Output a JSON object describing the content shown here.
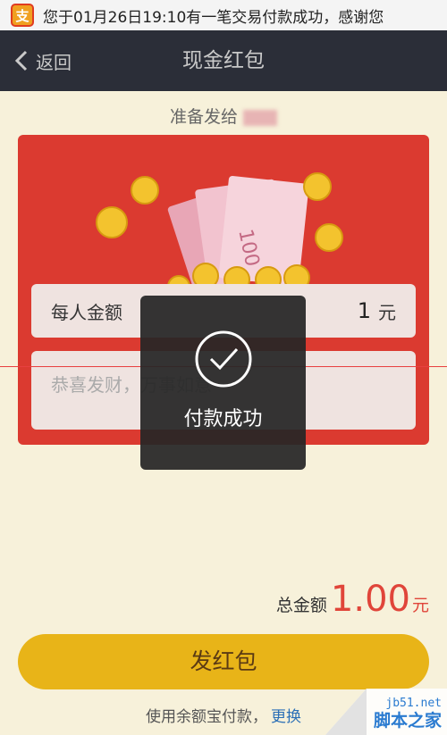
{
  "statusbar": {
    "app_icon_text": "支",
    "notification": "您于01月26日19:10有一笔交易付款成功，感谢您"
  },
  "navbar": {
    "back_label": "返回",
    "title": "现金红包"
  },
  "recipient": {
    "label": "准备发给"
  },
  "form": {
    "amount_label": "每人金额",
    "amount_value": "1",
    "amount_unit": "元",
    "message_placeholder": "恭喜发财，万事如意"
  },
  "toast": {
    "text": "付款成功"
  },
  "total": {
    "label": "总金额",
    "value": "1.00",
    "unit": "元"
  },
  "send_button": {
    "label": "发红包"
  },
  "payment": {
    "text": "使用余额宝付款，",
    "change_label": "更换"
  },
  "watermark": {
    "site": "jb51.net",
    "logo_text": "脚本之家"
  },
  "colors": {
    "nav_bg": "#2b2e38",
    "card_red": "#db3a30",
    "button_gold": "#e8b418",
    "total_red": "#e0453a",
    "link_blue": "#2b6fb6"
  },
  "icons": [
    "back-chevron-icon",
    "check-circle-icon",
    "alipay-app-icon",
    "coin-icon",
    "banknote-icon"
  ]
}
